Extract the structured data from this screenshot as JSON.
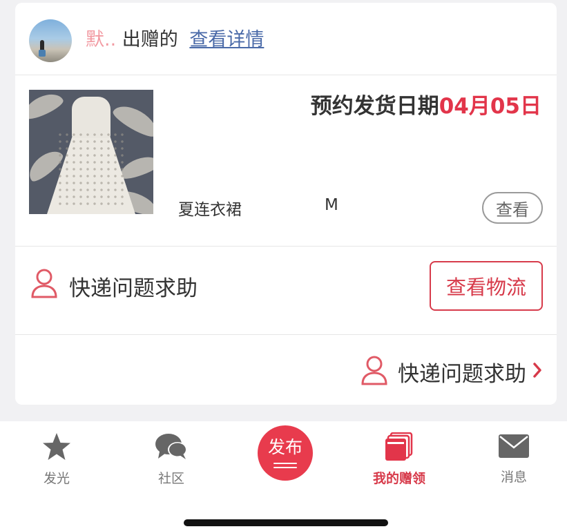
{
  "order": {
    "nickname": "默..",
    "gift_action": "出赠的",
    "detail_link": "查看详情",
    "ship_label": "预约发货日期",
    "ship_date": "04月05日",
    "product_name": "夏连衣裙",
    "product_size": "M",
    "view_label": "查看"
  },
  "help": {
    "help_text": "快递问题求助",
    "logistics_label": "查看物流",
    "help_link_text": "快递问题求助"
  },
  "tabbar": {
    "items": [
      {
        "label": "发光",
        "icon": "star-icon"
      },
      {
        "label": "社区",
        "icon": "chat-bubbles-icon"
      },
      {
        "label": "发布",
        "icon": "publish-icon"
      },
      {
        "label": "我的赠领",
        "icon": "cards-icon",
        "active": true
      },
      {
        "label": "消息",
        "icon": "envelope-icon"
      }
    ]
  },
  "colors": {
    "accent": "#e2354a",
    "link": "#4a6aa8",
    "nickname": "#f29aa2"
  }
}
